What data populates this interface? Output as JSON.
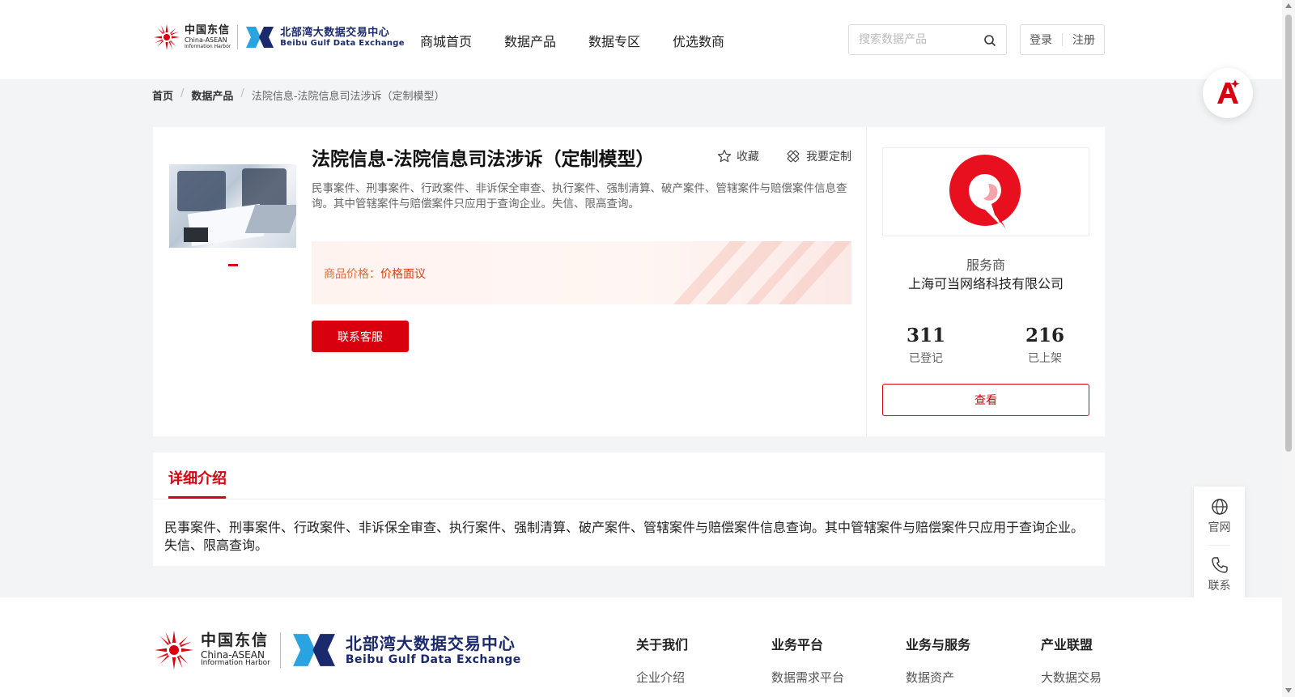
{
  "header": {
    "logo_cn": {
      "line1": "中国东信",
      "line2": "China-ASEAN",
      "line3": "Information Harbor"
    },
    "logo_bg": {
      "line1": "北部湾大数据交易中心",
      "line2": "Beibu Gulf Data Exchange"
    },
    "nav": [
      "商城首页",
      "数据产品",
      "数据专区",
      "优选数商"
    ],
    "search_placeholder": "搜索数据产品",
    "login": "登录",
    "register": "注册"
  },
  "breadcrumb": {
    "home": "首页",
    "category": "数据产品",
    "current": "法院信息-法院信息司法涉诉（定制模型）"
  },
  "product": {
    "title": "法院信息-法院信息司法涉诉（定制模型）",
    "favorite": "收藏",
    "customize": "我要定制",
    "description": "民事案件、刑事案件、行政案件、非诉保全审查、执行案件、强制清算、破产案件、管辖案件与赔偿案件信息查询。其中管辖案件与赔偿案件只应用于查询企业。失信、限高查询。",
    "price_label": "商品价格：",
    "price_value": "价格面议",
    "contact_button": "联系客服"
  },
  "vendor": {
    "label": "服务商",
    "name": "上海可当网络科技有限公司",
    "registered_count": "311",
    "registered_label": "已登记",
    "listed_count": "216",
    "listed_label": "已上架",
    "view_button": "查看"
  },
  "detail": {
    "tab": "详细介绍",
    "text": "民事案件、刑事案件、行政案件、非诉保全审查、执行案件、强制清算、破产案件、管辖案件与赔偿案件信息查询。其中管辖案件与赔偿案件只应用于查询企业。失信、限高查询。"
  },
  "side": {
    "website": "官网",
    "contact": "联系"
  },
  "footer": {
    "columns": [
      {
        "heading": "关于我们",
        "item": "企业介绍"
      },
      {
        "heading": "业务平台",
        "item": "数据需求平台"
      },
      {
        "heading": "业务与服务",
        "item": "数据资产"
      },
      {
        "heading": "产业联盟",
        "item": "大数据交易"
      }
    ]
  },
  "colors": {
    "brand_red": "#d8000f",
    "price_orange": "#e06a3c",
    "navy": "#1a2a6c"
  },
  "icons": [
    "search-icon",
    "star-icon",
    "customize-icon",
    "ai-assistant-icon",
    "globe-icon",
    "phone-icon"
  ]
}
